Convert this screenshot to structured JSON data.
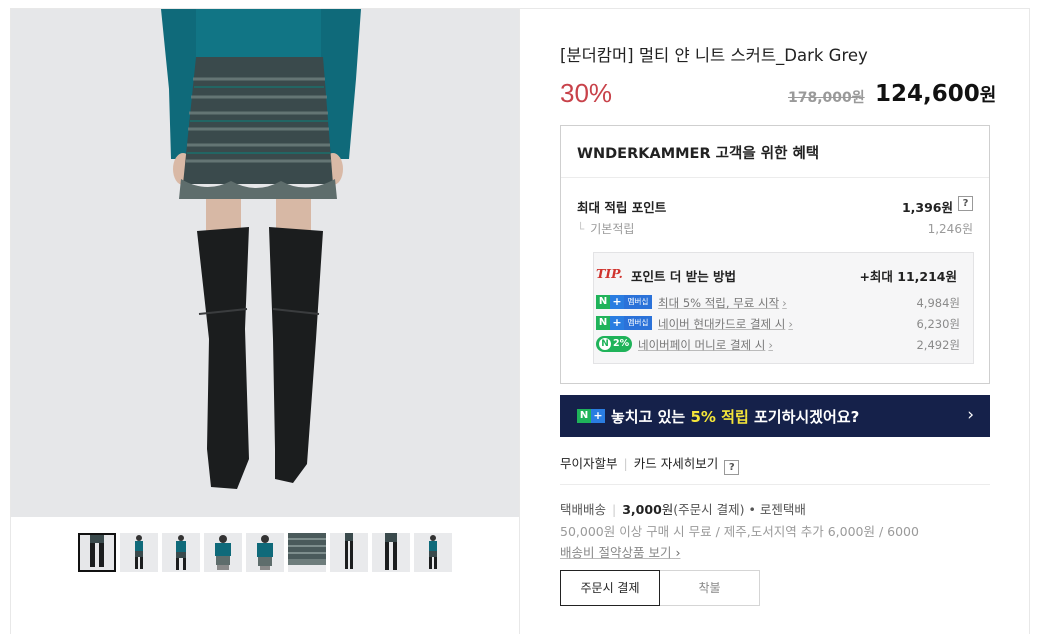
{
  "product": {
    "title": "[분더캄머] 멀티 얀 니트 스커트_Dark Grey",
    "discount": "30%",
    "original_price": "178,000원",
    "sale_price": "124,600",
    "sale_price_unit": "원"
  },
  "benefit": {
    "header": "WNDERKAMMER 고객을 위한 혜택",
    "max_point_label": "최대 적립 포인트",
    "max_point_value": "1,396원",
    "help": "?",
    "basic_label": "기본적립",
    "basic_value": "1,246원",
    "branch_glyph": "└",
    "tip": {
      "mark": "TIP.",
      "title": "포인트 더 받는 방법",
      "total": "+최대 11,214원",
      "rows": [
        {
          "text": "최대 5% 적립, 무료 시작",
          "value": "4,984원",
          "badge": "naver-plus-membership"
        },
        {
          "text": "네이버 현대카드로 결제 시",
          "value": "6,230원",
          "badge": "naver-plus-membership"
        },
        {
          "text": "네이버페이 머니로 결제 시",
          "value": "2,492원",
          "badge": "naverpay-2"
        }
      ],
      "badge_n": "N",
      "badge_plus": "+",
      "badge_member": "멤버십",
      "badge_pay_pct": "2%",
      "arrow": "›"
    }
  },
  "banner": {
    "msg_before": "놓치고 있는 ",
    "msg_highlight": "5% 적립",
    "msg_after": " 포기하시겠어요?",
    "chevron": "›"
  },
  "payment_info": {
    "installment": "무이자할부",
    "card_details": "카드 자세히보기",
    "help": "?",
    "separator": "|"
  },
  "shipping": {
    "type": "택배배송",
    "fee": "3,000",
    "fee_unit": "원",
    "fee_condition": "(주문시 결제)",
    "carrier": "• 로젠택배",
    "free_condition": "50,000원 이상 구매 시 무료 / 제주,도서지역 추가 6,000원 / 6000",
    "saving_link": "배송비 절약상품 보기",
    "saving_arrow": "›"
  },
  "pay_options": [
    "주문시 결제",
    "착불"
  ],
  "thumbnails": 9,
  "colors": {
    "discount": "#c8424a",
    "banner_bg": "#15214a",
    "banner_highlight": "#f4e53a",
    "naver_green": "#1fb35a",
    "naver_blue": "#2a7de1",
    "tip_red": "#d0332d"
  }
}
